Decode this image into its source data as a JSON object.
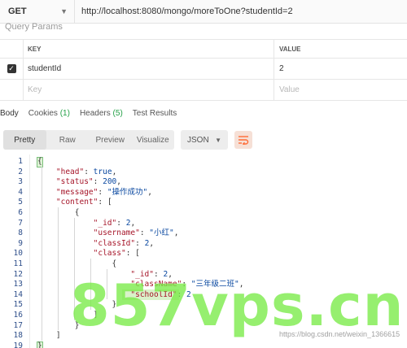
{
  "request": {
    "method": "GET",
    "url": "http://localhost:8080/mongo/moreToOne?studentId=2"
  },
  "query_params": {
    "title": "Query Params",
    "header": {
      "key": "KEY",
      "value": "VALUE"
    },
    "rows": [
      {
        "checked": true,
        "key": "studentId",
        "value": "2"
      }
    ],
    "placeholder": {
      "key": "Key",
      "value": "Value"
    }
  },
  "response_tabs": [
    {
      "label": "Body",
      "count": ""
    },
    {
      "label": "Cookies",
      "count": "(1)"
    },
    {
      "label": "Headers",
      "count": "(5)"
    },
    {
      "label": "Test Results",
      "count": ""
    }
  ],
  "view_modes": [
    "Pretty",
    "Raw",
    "Preview",
    "Visualize"
  ],
  "active_view": "Pretty",
  "format": {
    "selected": "JSON"
  },
  "code_lines": [
    "{",
    "    \"head\": true,",
    "    \"status\": 200,",
    "    \"message\": \"操作成功\",",
    "    \"content\": [",
    "        {",
    "            \"_id\": 2,",
    "            \"username\": \"小红\",",
    "            \"classId\": 2,",
    "            \"class\": [",
    "                {",
    "                    \"_id\": 2,",
    "                    \"className\": \"三年级二班\",",
    "                    \"schoolId\": 2",
    "                }",
    "            ]",
    "        }",
    "    ]",
    "}"
  ],
  "watermark": {
    "text": "857vps.cn",
    "url": "https://blog.csdn.net/weixin_1366615"
  },
  "colors": {
    "accent": "#ff6c37",
    "count_green": "#24a148",
    "json_key": "#a6162a",
    "json_value": "#0a48a0",
    "watermark": "#78eb46"
  },
  "icons": {
    "checkbox": "check-icon",
    "format_dropdown": "chevron-down-icon",
    "method_dropdown": "chevron-down-icon",
    "wrap": "wrap-lines-icon"
  }
}
